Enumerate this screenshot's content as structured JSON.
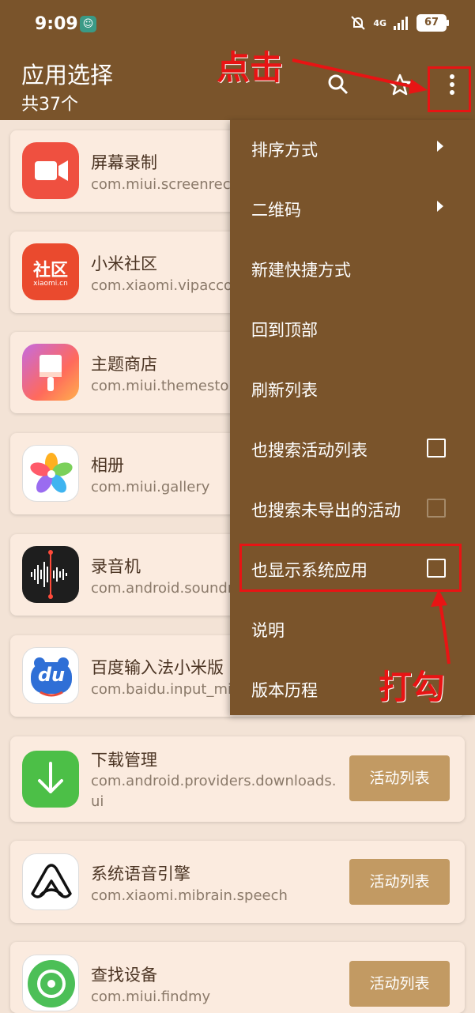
{
  "status_bar": {
    "time": "9:09",
    "network": "4G",
    "battery": "67"
  },
  "header": {
    "title": "应用选择",
    "subtitle": "共37个"
  },
  "apps": [
    {
      "name": "屏幕录制",
      "package": "com.miui.screenreco",
      "icon": "screen-record-icon"
    },
    {
      "name": "小米社区",
      "package": "com.xiaomi.vipaccou",
      "icon": "xiaomi-community-icon",
      "icon_text": "社区",
      "icon_subtext": "xiaomi.cn"
    },
    {
      "name": "主题商店",
      "package": "com.miui.themestore",
      "icon": "theme-store-icon"
    },
    {
      "name": "相册",
      "package": "com.miui.gallery",
      "icon": "gallery-icon"
    },
    {
      "name": "录音机",
      "package": "com.android.soundr",
      "icon": "sound-recorder-icon"
    },
    {
      "name": "百度输入法小米版",
      "package": "com.baidu.input_mi",
      "icon": "baidu-input-icon",
      "icon_text": "du"
    },
    {
      "name": "下载管理",
      "package": "com.android.providers.downloads.ui",
      "icon": "download-manager-icon",
      "action": "活动列表"
    },
    {
      "name": "系统语音引擎",
      "package": "com.xiaomi.mibrain.speech",
      "icon": "speech-engine-icon",
      "action": "活动列表"
    },
    {
      "name": "查找设备",
      "package": "com.miui.findmy",
      "icon": "find-device-icon",
      "action": "活动列表"
    }
  ],
  "menu": [
    {
      "label": "排序方式",
      "type": "submenu"
    },
    {
      "label": "二维码",
      "type": "submenu"
    },
    {
      "label": "新建快捷方式",
      "type": "item"
    },
    {
      "label": "回到顶部",
      "type": "item"
    },
    {
      "label": "刷新列表",
      "type": "item"
    },
    {
      "label": "也搜索活动列表",
      "type": "checkbox",
      "checked": false
    },
    {
      "label": "也搜索未导出的活动",
      "type": "checkbox",
      "checked": false,
      "enabled": false
    },
    {
      "label": "也显示系统应用",
      "type": "checkbox",
      "checked": false
    },
    {
      "label": "说明",
      "type": "item"
    },
    {
      "label": "版本历程",
      "type": "item"
    }
  ],
  "annotations": {
    "tap_label": "点击",
    "check_label": "打勾",
    "color": "#e81414"
  },
  "colors": {
    "appbar": "#7a542b",
    "background": "#f3e3d6",
    "card": "#fbebdf",
    "button": "#c29a63"
  }
}
